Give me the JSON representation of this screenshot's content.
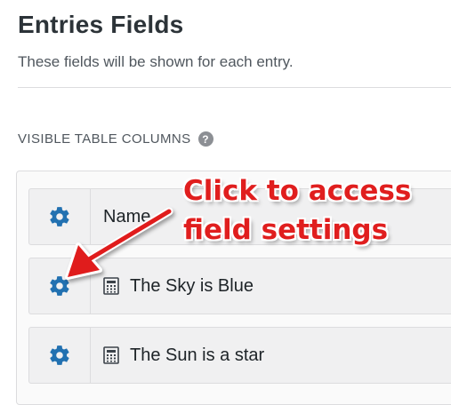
{
  "header": {
    "title": "Entries Fields",
    "subtitle": "These fields will be shown for each entry."
  },
  "section": {
    "label": "VISIBLE TABLE COLUMNS",
    "help_icon": "question-circle-icon"
  },
  "rows": [
    {
      "label": "Name",
      "settings_icon": "gear-icon",
      "type_icon": null
    },
    {
      "label": "The Sky is Blue",
      "settings_icon": "gear-icon",
      "type_icon": "calculator-icon"
    },
    {
      "label": "The Sun is a star",
      "settings_icon": "gear-icon",
      "type_icon": "calculator-icon"
    }
  ],
  "annotation": {
    "line1": "Click to access",
    "line2": "field settings",
    "color": "#e01e1e"
  },
  "colors": {
    "gear": "#2271b1",
    "title": "#2c3338"
  }
}
